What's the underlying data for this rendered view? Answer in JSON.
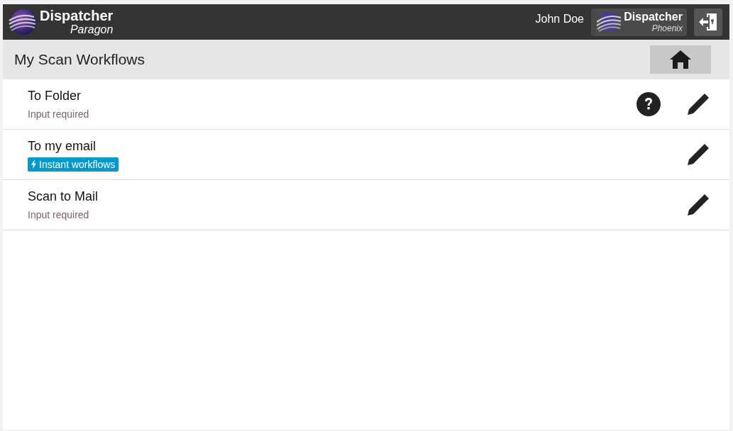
{
  "header": {
    "logo": {
      "name": "Dispatcher",
      "product": "Paragon"
    },
    "user": "John Doe",
    "switch_app": {
      "name": "Dispatcher",
      "product": "Phoenix"
    }
  },
  "title_bar": {
    "title": "My Scan Workflows"
  },
  "workflows": [
    {
      "title": "To Folder",
      "kind": "status",
      "subtitle": "Input required",
      "help": true
    },
    {
      "title": "To my email",
      "kind": "badge",
      "subtitle": "Instant workflows",
      "help": false
    },
    {
      "title": "Scan to Mail",
      "kind": "status",
      "subtitle": "Input required",
      "help": false
    }
  ]
}
